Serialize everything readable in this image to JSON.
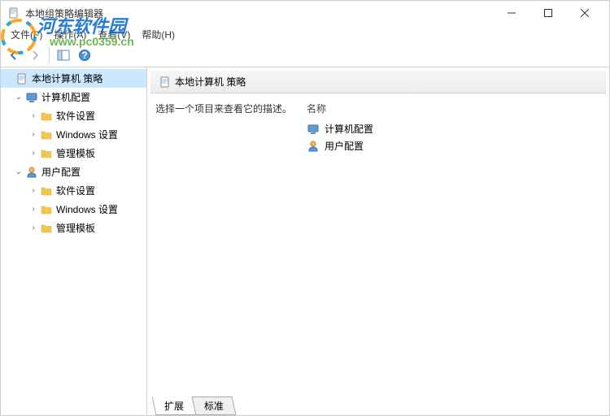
{
  "window": {
    "title": "本地组策略编辑器"
  },
  "menu": {
    "file": "文件(F)",
    "action": "操作(A)",
    "view": "查看(V)",
    "help": "帮助(H)"
  },
  "watermark": {
    "brand": "河东软件园",
    "url": "www.pc0359.cn"
  },
  "tree": {
    "root": "本地计算机 策略",
    "computer": "计算机配置",
    "software": "软件设置",
    "windows": "Windows 设置",
    "templates": "管理模板",
    "user": "用户配置"
  },
  "detail": {
    "header": "本地计算机 策略",
    "description": "选择一个项目来查看它的描述。",
    "nameCol": "名称",
    "items": {
      "computer": "计算机配置",
      "user": "用户配置"
    }
  },
  "tabs": {
    "extended": "扩展",
    "standard": "标准"
  }
}
